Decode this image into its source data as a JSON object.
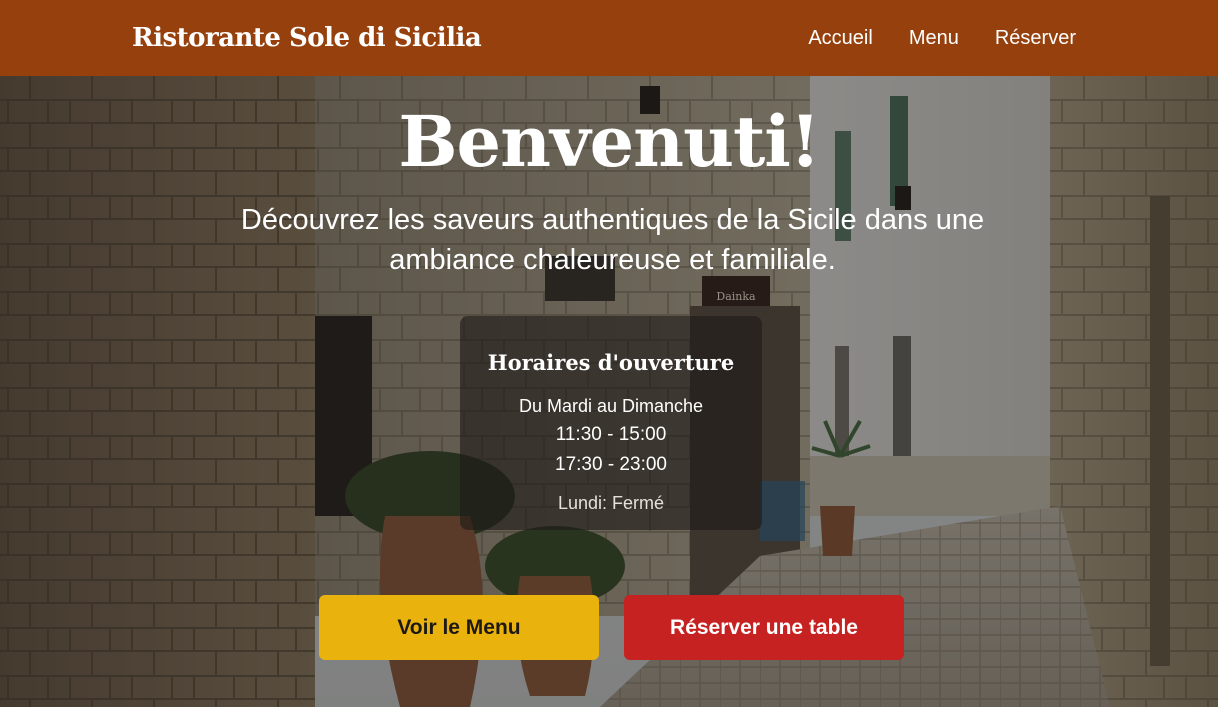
{
  "header": {
    "brand": "Ristorante Sole di Sicilia",
    "nav": [
      {
        "label": "Accueil"
      },
      {
        "label": "Menu"
      },
      {
        "label": "Réserver"
      }
    ]
  },
  "hero": {
    "title": "Benvenuti!",
    "subtitle": "Découvrez les saveurs authentiques de la Sicile dans une ambiance chaleureuse et familiale.",
    "background_image": "stone-alley-photo",
    "signs": [
      "Dainka"
    ]
  },
  "hours": {
    "title": "Horaires d'ouverture",
    "days": "Du Mardi au Dimanche",
    "slots": [
      "11:30 - 15:00",
      "17:30 - 23:00"
    ],
    "closed": "Lundi: Fermé"
  },
  "actions": {
    "menu_label": "Voir le Menu",
    "reserve_label": "Réserver une table"
  },
  "colors": {
    "header_bg": "#96410d",
    "menu_button": "#eab20c",
    "reserve_button": "#c72222"
  }
}
